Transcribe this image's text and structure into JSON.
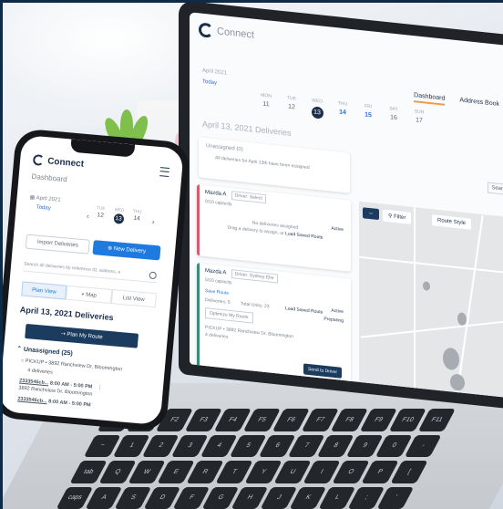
{
  "app": {
    "name": "Connect"
  },
  "laptop": {
    "nav": [
      "Dashboard",
      "Address Book"
    ],
    "month": "April 2021",
    "today": "Today",
    "days": [
      {
        "dow": "MON",
        "num": "11"
      },
      {
        "dow": "TUE",
        "num": "12"
      },
      {
        "dow": "WED",
        "num": "13"
      },
      {
        "dow": "THU",
        "num": "14"
      },
      {
        "dow": "FRI",
        "num": "15"
      },
      {
        "dow": "SAT",
        "num": "16"
      },
      {
        "dow": "SUN",
        "num": "17"
      }
    ],
    "heading": "April 13, 2021 Deliveries",
    "unassigned_title": "Unassigned (0)",
    "unassigned_msg": "All deliveries for April 13th have been assigned",
    "route1": {
      "name": "Mazda A",
      "driver": "Driver: Select",
      "capacity": "0/10 capacity",
      "active": "Active",
      "empty1": "No deliveries assigned",
      "empty2": "Drag a delivery to assign, or",
      "load": "Load Saved Route"
    },
    "route2": {
      "name": "Mazda A",
      "driver": "Driver: Sydney Eke",
      "capacity": "5/10 capacity",
      "save": "Save Route",
      "active": "Active",
      "preparing": "Preparing",
      "deliveries": "Deliveries: 5",
      "total": "Total Units: 23",
      "load": "Load Saved Route",
      "optimize": "Optimize My Route",
      "send": "Send to Driver",
      "pickup": "PICKUP • 3892 Ranchview Dr, Bloomington",
      "count": "4 deliveries"
    },
    "map_filter": "Filter",
    "map_style": "Route Style",
    "search": "Sear"
  },
  "phone": {
    "title": "Dashboard",
    "month": "April 2021",
    "today": "Today",
    "days": [
      {
        "dow": "TUE",
        "num": "12"
      },
      {
        "dow": "WED",
        "num": "13"
      },
      {
        "dow": "THU",
        "num": "14"
      }
    ],
    "import": "Import Deliveries",
    "new": "New Delivery",
    "search": "Search all deliveries by reference ID, address, e",
    "tabs": [
      "Plan View",
      "Map",
      "List View"
    ],
    "date_heading": "April 13, 2021 Deliveries",
    "plan": "Plan My Route",
    "unassigned": "Unassigned (25)",
    "pickup": "PICKUP • 3892 Ranchview Dr, Bloomington",
    "count": "4 deliveries",
    "item1_id": "2333546cb...",
    "item1_time": "8:00 AM - 5:00 PM",
    "item1_addr": "3892 Ranchview Dr, Bloomington",
    "item2_id": "2333546cb...",
    "item2_time": "8:00 AM - 5:00 PM"
  },
  "keyboard": {
    "keys": [
      "esc",
      "F1",
      "F2",
      "F3",
      "F4",
      "F5",
      "F6",
      "F7",
      "F8",
      "F9",
      "F10",
      "F11",
      "~",
      "1",
      "2",
      "3",
      "4",
      "5",
      "6",
      "7",
      "8",
      "9",
      "0",
      "-",
      "tab",
      "Q",
      "W",
      "E",
      "R",
      "T",
      "Y",
      "U",
      "I",
      "O",
      "P",
      "[",
      "caps",
      "A",
      "S",
      "D",
      "F",
      "G",
      "H",
      "J",
      "K",
      "L",
      ";",
      "'"
    ]
  }
}
